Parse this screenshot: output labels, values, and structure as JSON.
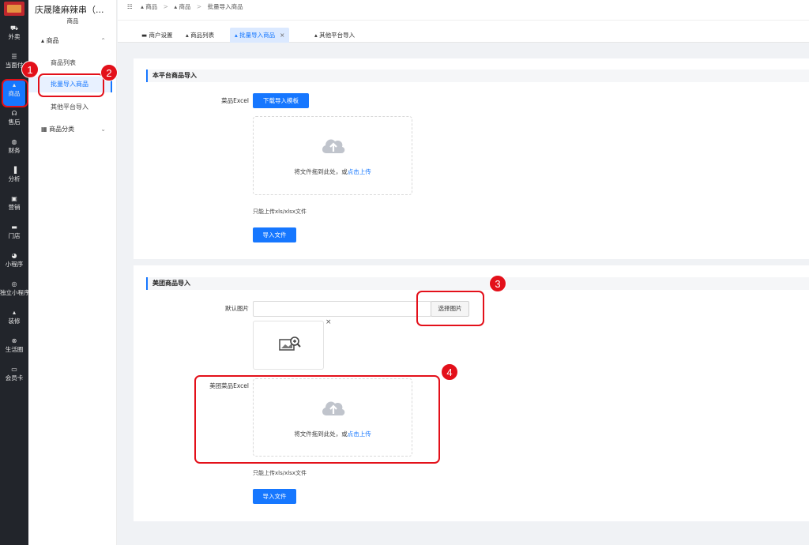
{
  "rail": {
    "items": [
      {
        "label": "外卖",
        "icon": "⛟"
      },
      {
        "label": "当面付",
        "icon": "☰"
      },
      {
        "label": "商品",
        "icon": "▴"
      },
      {
        "label": "售后",
        "icon": "☊"
      },
      {
        "label": "财务",
        "icon": "◍"
      },
      {
        "label": "分析",
        "icon": "▐"
      },
      {
        "label": "营销",
        "icon": "▣"
      },
      {
        "label": "门店",
        "icon": "▬"
      },
      {
        "label": "小程序",
        "icon": "◕"
      },
      {
        "label": "独立小程序",
        "icon": "◎"
      },
      {
        "label": "装修",
        "icon": "▴"
      },
      {
        "label": "生活圈",
        "icon": "⊗"
      },
      {
        "label": "会员卡",
        "icon": "▭"
      }
    ]
  },
  "subnav": {
    "shop_name": "庆晟隆麻辣串（...",
    "shop_sub": "商品",
    "group1": "商品",
    "items": [
      "商品列表",
      "批量导入商品",
      "其他平台导入"
    ],
    "group2": "商品分类"
  },
  "breadcrumb": [
    "商品",
    "商品",
    "批量导入商品"
  ],
  "tabs": [
    "商户设置",
    "商品列表",
    "批量导入商品",
    "其他平台导入"
  ],
  "section1": {
    "title": "本平台商品导入",
    "excel_label": "菜品Excel",
    "download_btn": "下载导入模板",
    "drop_text": "将文件拖到此处，或",
    "drop_link": "点击上传",
    "hint": "只能上传xls/xlsx文件",
    "import_btn": "导入文件"
  },
  "section2": {
    "title": "美团商品导入",
    "image_label": "默认图片",
    "choose_btn": "选择图片",
    "excel_label": "美团菜品Excel",
    "drop_text": "将文件拖到此处，或",
    "drop_link": "点击上传",
    "hint": "只能上传xls/xlsx文件",
    "import_btn": "导入文件"
  },
  "annotations": [
    "1",
    "2",
    "3",
    "4"
  ],
  "colors": {
    "accent": "#1677ff",
    "annotation": "#e3101a",
    "rail": "#22252b"
  }
}
